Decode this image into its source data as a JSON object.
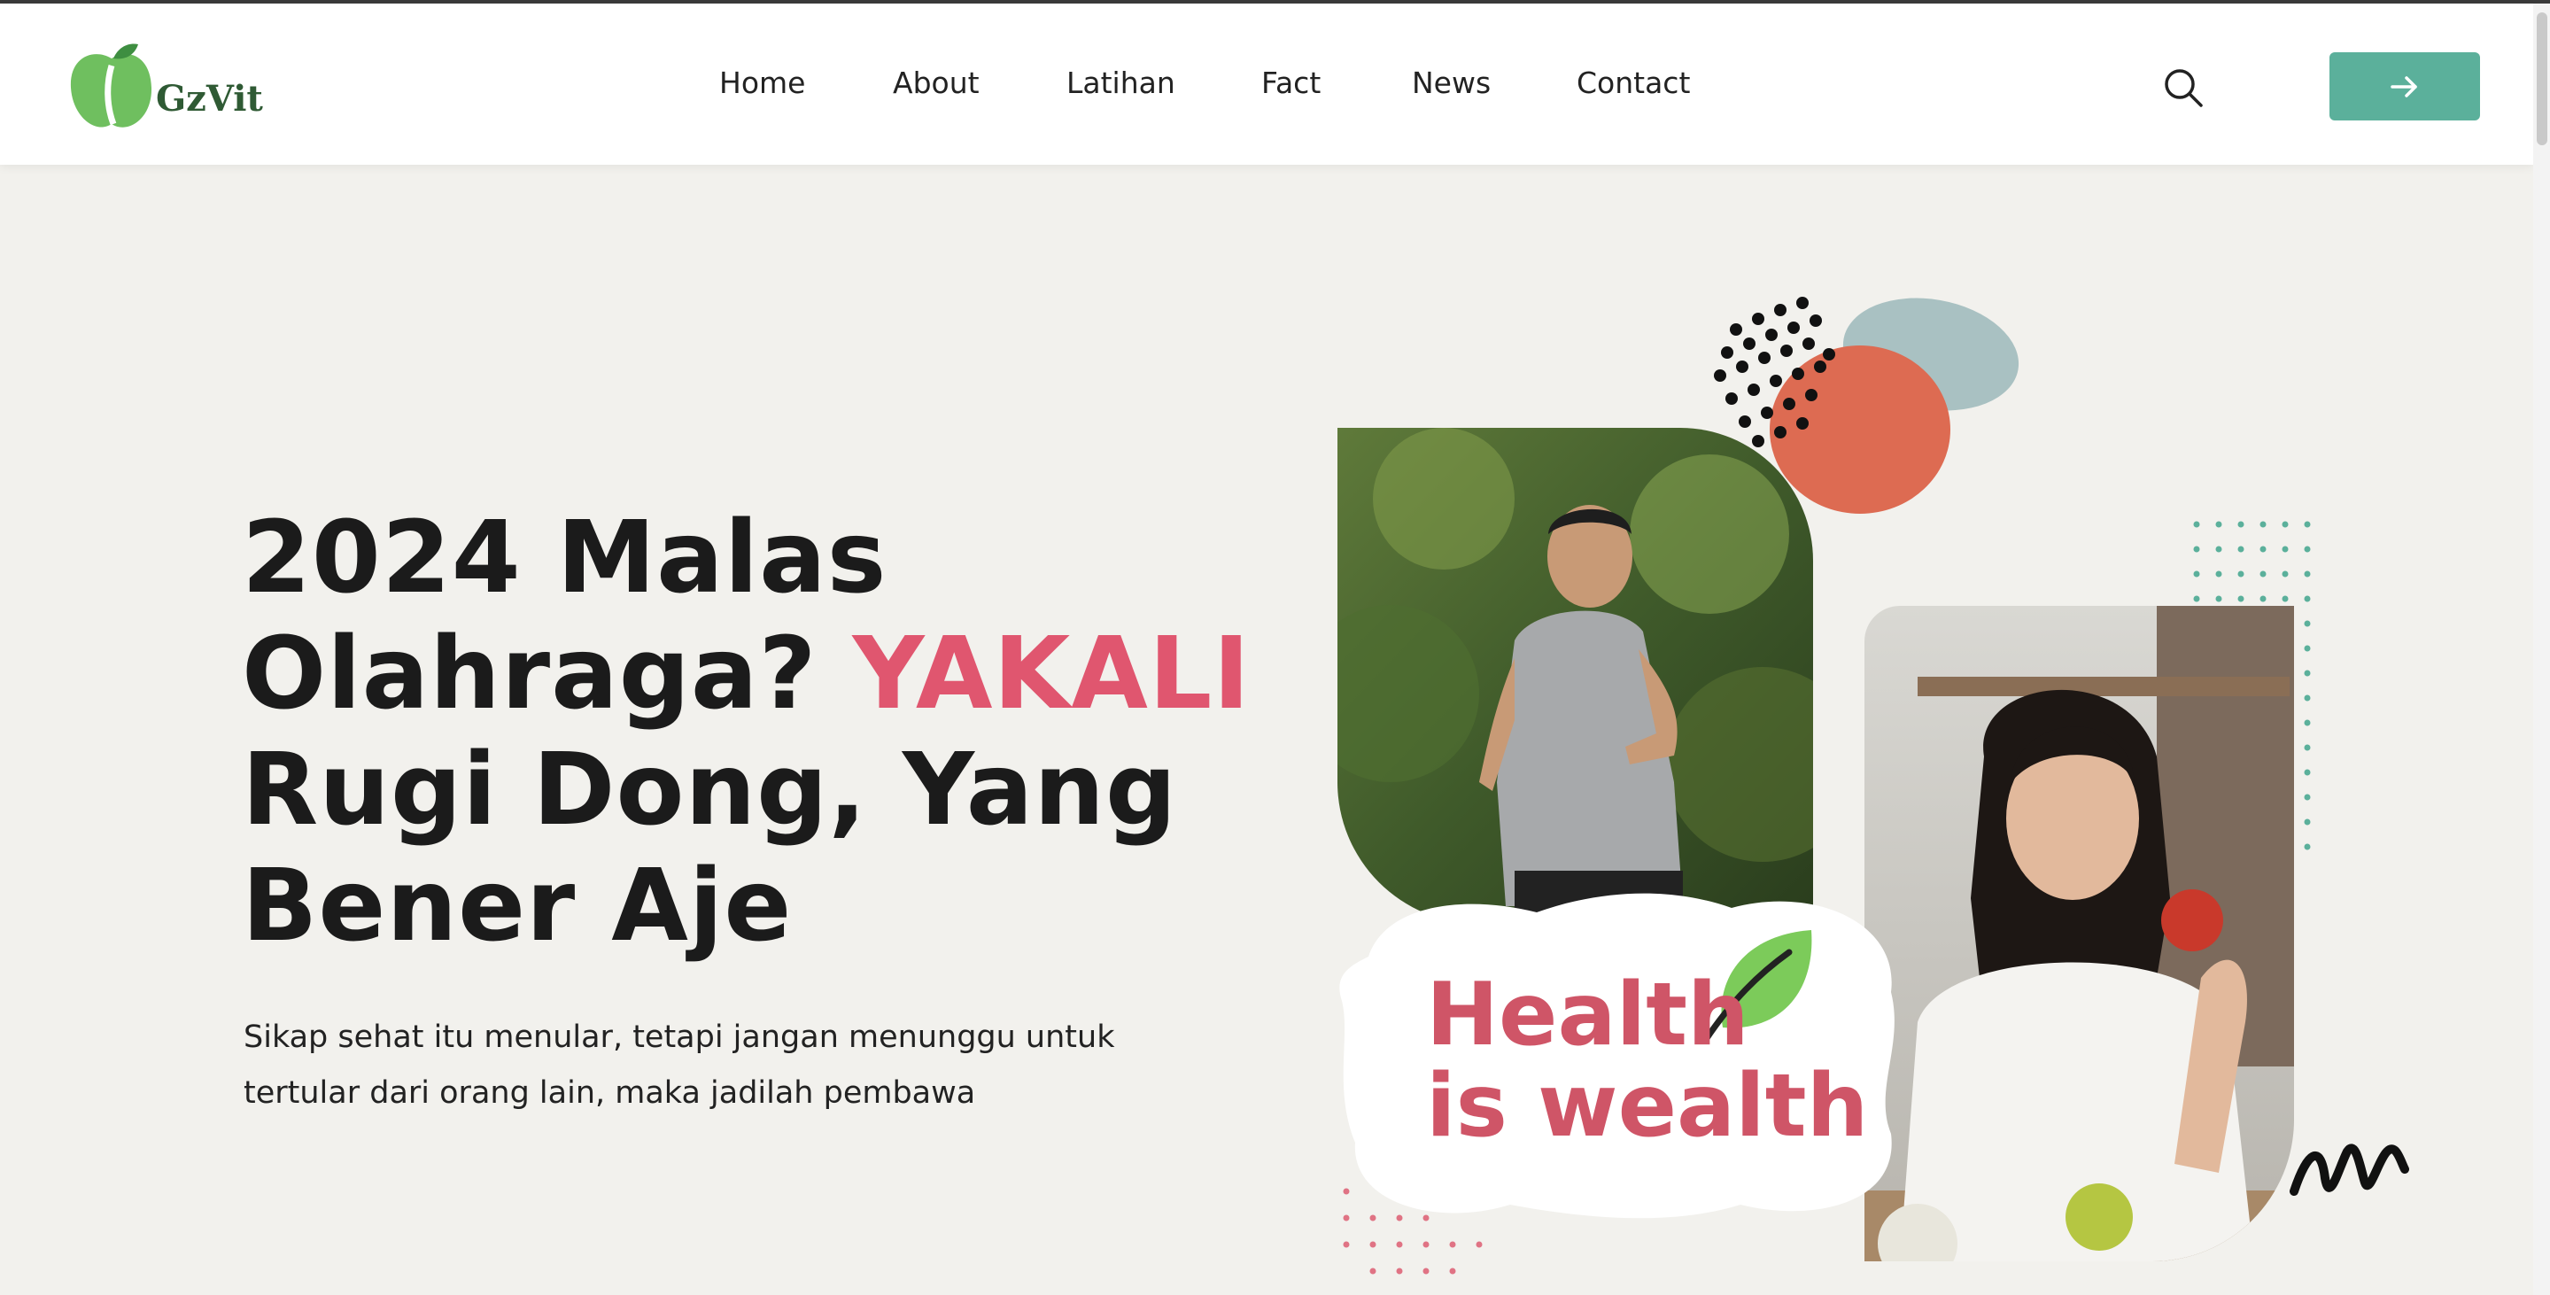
{
  "header": {
    "logo_text": "GzVit",
    "nav": [
      {
        "label": "Home"
      },
      {
        "label": "About"
      },
      {
        "label": "Latihan"
      },
      {
        "label": "Fact"
      },
      {
        "label": "News"
      },
      {
        "label": "Contact"
      }
    ],
    "search_icon": "search-icon",
    "cta_icon": "arrow-right-icon"
  },
  "hero": {
    "title_line1": "2024 Malas",
    "title_line2": "Olahraga?",
    "title_accent": "YAKALI",
    "title_line3": "Rugi Dong, Yang",
    "title_line4": "Bener Aje",
    "description_line1": "Sikap sehat itu menular, tetapi jangan menunggu untuk",
    "description_line2": "tertular dari orang lain, maka jadilah pembawa"
  },
  "art": {
    "badge_line1": "Health",
    "badge_line2": "is wealth",
    "leaf_icon": "leaf-icon"
  },
  "colors": {
    "accent_red": "#e0566f",
    "brand_green": "#5bb09b",
    "logo_green": "#2f5a34",
    "background": "#f2f1ed"
  }
}
